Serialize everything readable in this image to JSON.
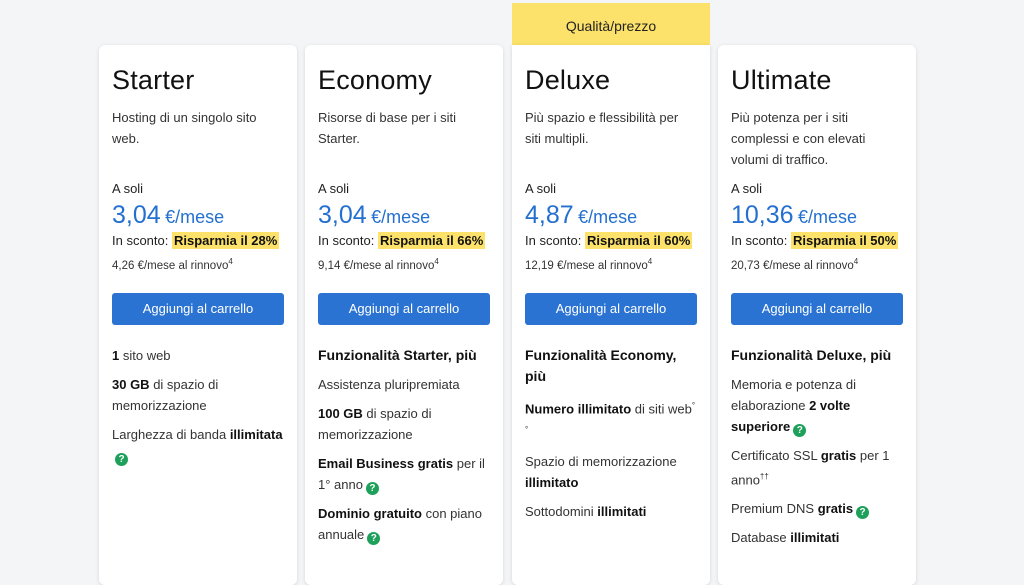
{
  "ribbon": {
    "label": "Qualità/prezzo"
  },
  "common": {
    "from_label": "A soli",
    "discount_label": "In sconto:",
    "cta_label": "Aggiungi al carrello",
    "currency_unit": "€/mese",
    "help_glyph": "?"
  },
  "plans": [
    {
      "name": "Starter",
      "description": "Hosting di un singolo sito web.",
      "price": "3,04",
      "savings": "Risparmia il 28%",
      "renewal": "4,26 €/mese al rinnovo",
      "renewal_note": "4",
      "features": {
        "f1_bold": "1",
        "f1_text": " sito web",
        "f2_bold": "30 GB",
        "f2_text": " di spazio di memorizzazione",
        "f3_text": "Larghezza di banda ",
        "f3_bold": "illimitata"
      }
    },
    {
      "name": "Economy",
      "description": "Risorse di base per i siti Starter.",
      "price": "3,04",
      "savings": "Risparmia il 66%",
      "renewal": "9,14 €/mese al rinnovo",
      "renewal_note": "4",
      "features": {
        "heading": "Funzionalità Starter, più",
        "f1_text": "Assistenza pluripremiata",
        "f2_bold": "100 GB",
        "f2_text": " di spazio di memorizzazione",
        "f3_bold": "Email Business gratis",
        "f3_text": " per il 1° anno",
        "f4_bold": "Dominio gratuito",
        "f4_text": " con piano annuale"
      }
    },
    {
      "name": "Deluxe",
      "description": "Più spazio e flessibilità per siti multipli.",
      "price": "4,87",
      "savings": "Risparmia il 60%",
      "renewal": "12,19 €/mese al rinnovo",
      "renewal_note": "4",
      "features": {
        "heading": "Funzionalità Economy, più",
        "f1_bold": "Numero illimitato",
        "f1_text": " di siti web",
        "f1_note": "°°",
        "f2_text": "Spazio di memorizzazione ",
        "f2_bold": "illimitato",
        "f3_text": "Sottodomini ",
        "f3_bold": "illimitati"
      }
    },
    {
      "name": "Ultimate",
      "description": "Più potenza per i siti complessi e con elevati volumi di traffico.",
      "price": "10,36",
      "savings": "Risparmia il 50%",
      "renewal": "20,73 €/mese al rinnovo",
      "renewal_note": "4",
      "features": {
        "heading": "Funzionalità Deluxe, più",
        "f1_text": "Memoria e potenza di elaborazione ",
        "f1_bold": "2 volte superiore",
        "f2_text": "Certificato SSL ",
        "f2_bold": "gratis",
        "f2_text2": " per 1 anno",
        "f2_note": "††",
        "f3_text": "Premium DNS ",
        "f3_bold": "gratis",
        "f4_text": "Database ",
        "f4_bold": "illimitati"
      }
    }
  ],
  "colors": {
    "accent_blue": "#2b73d3",
    "price_blue": "#2470d0",
    "highlight_yellow": "#fce26a",
    "help_green": "#1da05a",
    "background": "#f4f5f7"
  },
  "icons": {
    "help": "question-circle-icon",
    "ribbon_pointer": "caret-down-icon"
  }
}
